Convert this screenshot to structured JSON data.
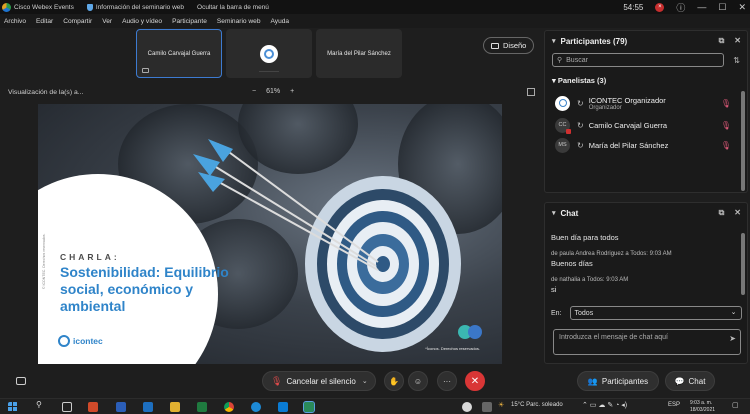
{
  "titlebar": {
    "app": "Cisco Webex Events",
    "seminar_info": "Información del seminario web",
    "hide_menu": "Ocultar la barra de menú",
    "time": "54:55",
    "close_badge": "×"
  },
  "menu": [
    "Archivo",
    "Editar",
    "Compartir",
    "Ver",
    "Audio y vídeo",
    "Participante",
    "Seminario web",
    "Ayuda"
  ],
  "thumbnails": {
    "first": "Camilo Carvajal Guerra",
    "third": "María del Pilar Sánchez"
  },
  "layout_button": "Diseño",
  "viewbar": {
    "label": "Visualización de la(s) a...",
    "zoom_minus": "−",
    "zoom": "61%",
    "zoom_plus": "+"
  },
  "slide": {
    "charla": "CHARLA:",
    "title": "Sostenibilidad: Equilibrio social, económico y ambiental",
    "brand": "icontec",
    "credits": "*Íconos. Derechos reservados.",
    "copyright": "© ICONTEC. Derechos reservados."
  },
  "participants": {
    "title": "Participantes (79)",
    "search_placeholder": "Buscar",
    "panelists_title": "Panelistas (3)",
    "people": [
      {
        "name": "ICONTEC Organizador",
        "role": "Organizador",
        "initials": ""
      },
      {
        "name": "Camilo Carvajal Guerra",
        "role": "",
        "initials": "CC"
      },
      {
        "name": "María del Pilar Sánchez",
        "role": "",
        "initials": "MS"
      }
    ]
  },
  "chat": {
    "title": "Chat",
    "messages": [
      {
        "meta": "",
        "text": "Buen día para todos"
      },
      {
        "meta": "de paula Andrea Rodriguez a Todos:   9:03 AM",
        "text": "Buenos días"
      },
      {
        "meta": "de nathalia a Todos:   9:03 AM",
        "text": "si"
      }
    ],
    "to_label": "En:",
    "to_value": "Todos",
    "input_placeholder": "Introduzca el mensaje de chat aquí"
  },
  "controls": {
    "mute": "Cancelar el silencio",
    "participants": "Participantes",
    "chat": "Chat"
  },
  "taskbar": {
    "weather": "15°C  Parc. soleado",
    "lang": "ESP",
    "time": "9:03 a. m.",
    "date": "18/03/2021"
  }
}
